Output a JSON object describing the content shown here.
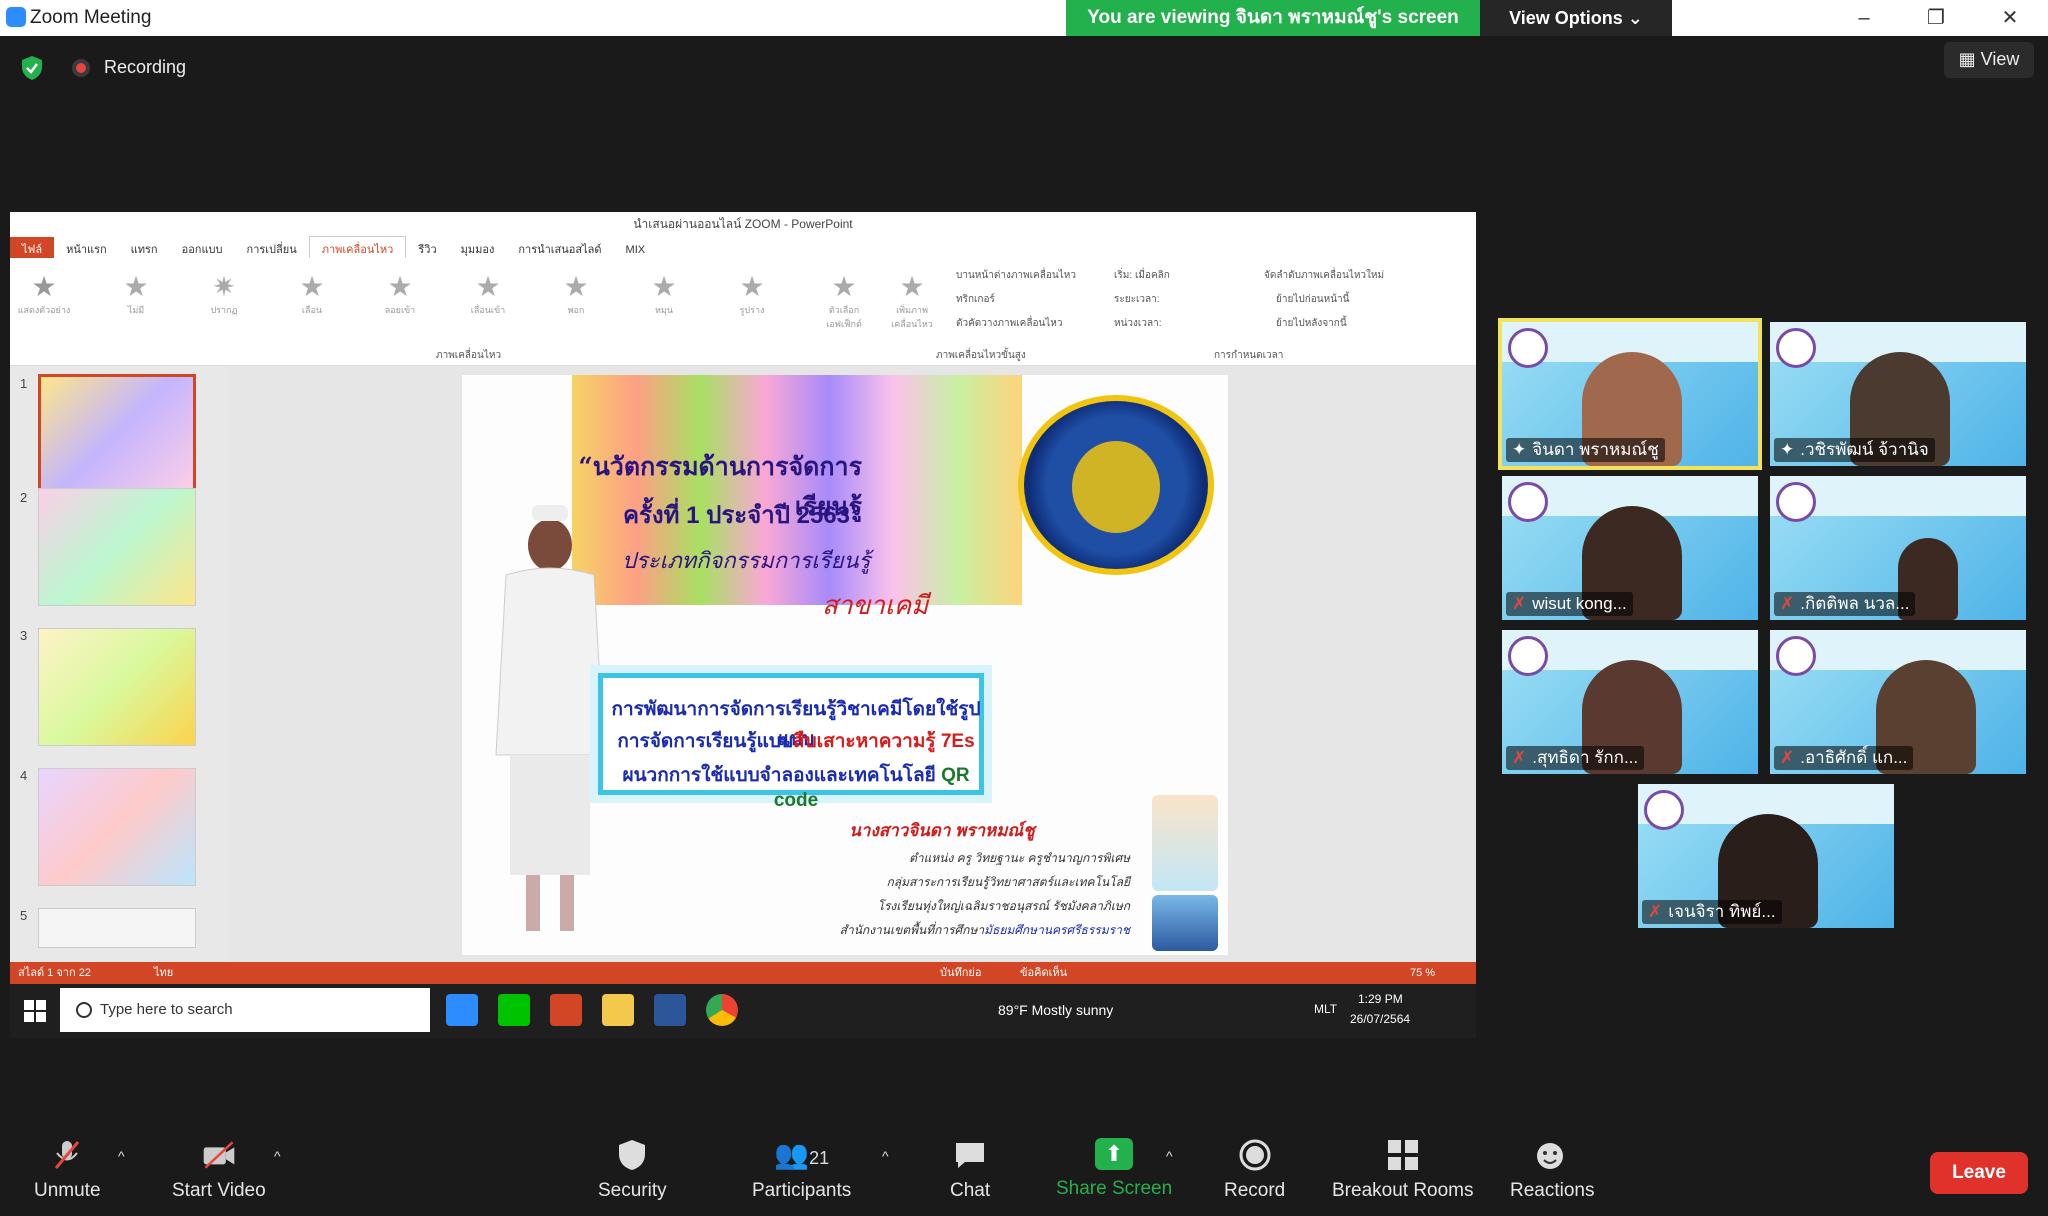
{
  "window": {
    "title": "Zoom Meeting",
    "viewing_banner": "You are viewing จินดา พราหมณ์ชู's screen",
    "view_options": "View Options ⌄",
    "minimize": "–",
    "restore": "❐",
    "close": "✕"
  },
  "status": {
    "recording": "Recording",
    "view": "View"
  },
  "powerpoint": {
    "title": "นำเสนอผ่านออนไลน์ ZOOM - PowerPoint",
    "tabs": [
      "ไฟล์",
      "หน้าแรก",
      "แทรก",
      "ออกแบบ",
      "การเปลี่ยน",
      "ภาพเคลื่อนไหว",
      "รีวิว",
      "มุมมอง",
      "การนำเสนอสไลด์",
      "MIX"
    ],
    "ribbon_effects": [
      "ไม่มี",
      "ปรากฏ",
      "เลือน",
      "ลอยเข้า",
      "เลื่อนเข้า",
      "พอก",
      "หมุน",
      "รูปร่าง"
    ],
    "ribbon_preview": "แสดงตัวอย่าง",
    "ribbon_group_label": "ภาพเคลื่อนไหว",
    "ribbon_effect_options": "ตัวเลือกเอฟเฟ็กต์",
    "ribbon_add": "เพิ่มภาพเคลื่อนไหว",
    "ribbon_pane": "บานหน้าต่างภาพเคลื่อนไหว",
    "ribbon_trigger": "ทริกเกอร์",
    "ribbon_painter": "ตัวคัดวางภาพเคลื่อนไหว",
    "ribbon_advanced": "ภาพเคลื่อนไหวขั้นสูง",
    "ribbon_start": "เริ่ม: เมื่อคลิก",
    "ribbon_duration": "ระยะเวลา:",
    "ribbon_delay": "หน่วงเวลา:",
    "ribbon_timing": "การกำหนดเวลา",
    "ribbon_reorder": "จัดลำดับภาพเคลื่อนไหวใหม่",
    "ribbon_earlier": "ย้ายไปก่อนหน้านี้",
    "ribbon_later": "ย้ายไปหลังจากนี้",
    "slide_numbers": [
      "1",
      "2",
      "3",
      "4",
      "5"
    ],
    "status_left": "สไลด์ 1 จาก 22",
    "status_lang": "ไทย",
    "status_notes": "บันทึกย่อ",
    "status_comments": "ข้อคิดเห็น",
    "zoom": "75 %"
  },
  "slide": {
    "title_line1": "“นวัตกรรมด้านการจัดการเรียนรู้",
    "title_line2": "ครั้งที่ 1 ประจำปี 2563”",
    "title_line3": "ประเภทกิจกรรมการเรียนรู้",
    "subject": "สาขาเคมี",
    "box_line1": "การพัฒนาการจัดการเรียนรู้วิชาเคมีโดยใช้รูปแบบ",
    "box_line2a": "การจัดการเรียนรู้แบบ",
    "box_line2b": "สืบเสาะหาความรู้ 7Es",
    "box_line3a": "ผนวกการใช้แบบจำลองและเทคโนโลยี",
    "box_line3b": "QR code",
    "author": "นางสาวจินดา พราหมณ์ชู",
    "info1": "ตำแหน่ง ครู วิทยฐานะ ครูชำนาญการพิเศษ",
    "info2": "กลุ่มสาระการเรียนรู้วิทยาศาสตร์และเทคโนโลยี",
    "info3": "โรงเรียนทุ่งใหญ่เฉลิมราชอนุสรณ์ รัชมังคลาภิเษก",
    "info4a": "สำนักงานเขตพื้นที่การศึกษา",
    "info4b": "มัธยมศึกษานครศรีธรรมราช"
  },
  "taskbar": {
    "search_placeholder": "Type here to search",
    "weather": "89°F  Mostly sunny",
    "lang": "MLT",
    "time": "1:29 PM",
    "date": "26/07/2564"
  },
  "participants_tiles": [
    {
      "name": "จินดา พราหมณ์ชู",
      "muted": false
    },
    {
      "name": ".วชิรพัฒน์ จ้วานิจ",
      "muted": false
    },
    {
      "name": "wisut kong...",
      "muted": true
    },
    {
      "name": ".กิตติพล นวล...",
      "muted": true
    },
    {
      "name": ".สุทธิดา รักก...",
      "muted": true
    },
    {
      "name": ".อาธิศักดิ์ แก...",
      "muted": true
    },
    {
      "name": "เจนจิรา ทิพย์...",
      "muted": true
    }
  ],
  "toolbar": {
    "unmute": "Unmute",
    "start_video": "Start Video",
    "security": "Security",
    "participants": "Participants",
    "participants_count": "21",
    "chat": "Chat",
    "share_screen": "Share Screen",
    "record": "Record",
    "breakout_rooms": "Breakout Rooms",
    "reactions": "Reactions",
    "leave": "Leave"
  }
}
